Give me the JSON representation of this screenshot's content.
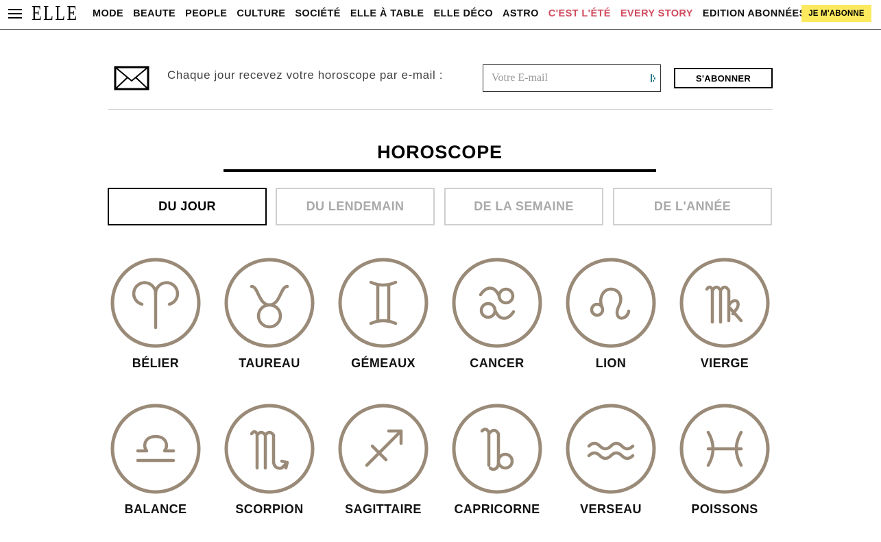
{
  "header": {
    "logo": "ELLE",
    "nav": [
      {
        "label": "MODE",
        "highlight": false
      },
      {
        "label": "BEAUTE",
        "highlight": false
      },
      {
        "label": "PEOPLE",
        "highlight": false
      },
      {
        "label": "CULTURE",
        "highlight": false
      },
      {
        "label": "SOCIÉTÉ",
        "highlight": false
      },
      {
        "label": "ELLE À TABLE",
        "highlight": false
      },
      {
        "label": "ELLE DÉCO",
        "highlight": false
      },
      {
        "label": "ASTRO",
        "highlight": false
      },
      {
        "label": "C'EST L'ÉTÉ",
        "highlight": true
      },
      {
        "label": "EVERY STORY",
        "highlight": true
      },
      {
        "label": "EDITION ABONNÉES",
        "highlight": false
      }
    ],
    "cta": "JE M'ABONNE"
  },
  "newsletter": {
    "text": "Chaque jour recevez votre horoscope par e-mail :",
    "email_placeholder": "Votre E-mail",
    "email_value": "",
    "button": "S'ABONNER"
  },
  "title": "HOROSCOPE",
  "tabs": [
    {
      "label": "DU JOUR",
      "active": true
    },
    {
      "label": "DU LENDEMAIN",
      "active": false
    },
    {
      "label": "DE LA SEMAINE",
      "active": false
    },
    {
      "label": "DE L'ANNÉE",
      "active": false
    }
  ],
  "signs": [
    {
      "label": "BÉLIER",
      "icon": "aries-icon"
    },
    {
      "label": "TAUREAU",
      "icon": "taurus-icon"
    },
    {
      "label": "GÉMEAUX",
      "icon": "gemini-icon"
    },
    {
      "label": "CANCER",
      "icon": "cancer-icon"
    },
    {
      "label": "LION",
      "icon": "leo-icon"
    },
    {
      "label": "VIERGE",
      "icon": "virgo-icon"
    },
    {
      "label": "BALANCE",
      "icon": "libra-icon"
    },
    {
      "label": "SCORPION",
      "icon": "scorpio-icon"
    },
    {
      "label": "SAGITTAIRE",
      "icon": "sagittarius-icon"
    },
    {
      "label": "CAPRICORNE",
      "icon": "capricorn-icon"
    },
    {
      "label": "VERSEAU",
      "icon": "aquarius-icon"
    },
    {
      "label": "POISSONS",
      "icon": "pisces-icon"
    }
  ],
  "colors": {
    "sign_stroke": "#9a8a78",
    "nav_highlight": "#d14a5e",
    "cta_background": "#fde95e"
  }
}
